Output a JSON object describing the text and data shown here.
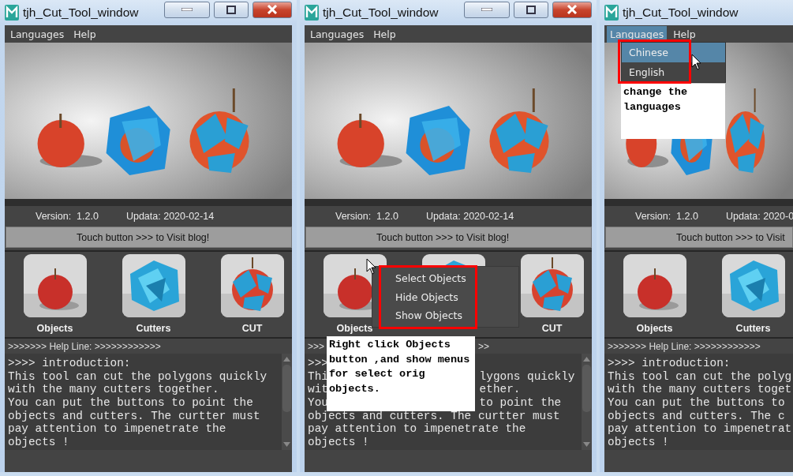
{
  "windows": [
    {
      "title": "tjh_Cut_Tool_window",
      "controls": true,
      "scrollbar": true,
      "menu": [
        {
          "label": "Languages",
          "open": false
        },
        {
          "label": "Help",
          "open": false
        }
      ],
      "version": "Version:  1.2.0",
      "date": "Updata: 2020-02-14",
      "visit_button": "Touch button >>> to Visit blog!",
      "tools": [
        {
          "kind": "picture",
          "label": "Objects"
        },
        {
          "kind": "picture",
          "label": "Cutters"
        },
        {
          "kind": "picture",
          "label": "CUT"
        }
      ],
      "help_line": [
        ">>>>>>> Help Line: >>>>>>>>>>>>"
      ],
      "help_text": [
        [
          ">>>> introduction:"
        ],
        [
          "This tool can cut the polygons quickly"
        ],
        [
          "with the many cutters together."
        ],
        [
          "You can put the buttons to point the"
        ],
        [
          "objects and cutters. The curtter must"
        ],
        [
          "pay attention to impenetrate the"
        ],
        [
          "objects !"
        ]
      ]
    },
    {
      "title": "tjh_Cut_Tool_window",
      "controls": true,
      "scrollbar": true,
      "menu": [
        {
          "label": "Languages",
          "open": false
        },
        {
          "label": "Help",
          "open": false
        }
      ],
      "version": "Version:  1.2.0",
      "date": "Updata: 2020-02-14",
      "visit_button": "Touch button >>> to Visit blog!",
      "tools": [
        {
          "kind": "picture",
          "label": "Objects"
        },
        {
          "kind": "picture"
        },
        {
          "kind": "picture",
          "label": "CUT"
        }
      ],
      "context_menu": [
        "Select Objects",
        "Hide Objects",
        "Show Objects"
      ],
      "note": "Right click Objects button ,and show menus for select orig objects.",
      "help_line": [
        ">>>",
        ">>"
      ],
      "help_text": [
        [
          ">>>"
        ],
        [
          "Thi",
          "lygons quickly"
        ],
        [
          "wit",
          "ether."
        ],
        [
          "You",
          "to point the"
        ],
        [
          "objects and cutters. The curtter must"
        ],
        [
          "pay attention to impenetrate the"
        ],
        [
          "objects !"
        ]
      ]
    },
    {
      "title": "tjh_Cut_Tool_window",
      "controls": false,
      "scrollbar": false,
      "menu": [
        {
          "label": "Languages",
          "open": true
        },
        {
          "label": "Help",
          "open": false
        }
      ],
      "dropdown": [
        {
          "label": "Chinese",
          "selected": true
        },
        {
          "label": "English",
          "selected": false
        }
      ],
      "note": "change the languages",
      "version": "Version:  1.2.0",
      "date": "Updata: 2020-0",
      "visit_button": "Touch button >>> to Visit",
      "tools": [
        {
          "kind": "picture",
          "label": "Objects"
        },
        {
          "kind": "picture",
          "label": "Cutters"
        }
      ],
      "help_line": [
        ">>>>>>> Help Line: >>>>>>>>>>>>"
      ],
      "help_text": [
        [
          ">>>> introduction:"
        ],
        [
          "This tool can cut the polyg"
        ],
        [
          "with the many cutters toget"
        ],
        [
          "You can put the buttons to"
        ],
        [
          "objects and cutters. The c"
        ],
        [
          "pay attention to impenetrat"
        ],
        [
          "objects !"
        ]
      ]
    }
  ]
}
